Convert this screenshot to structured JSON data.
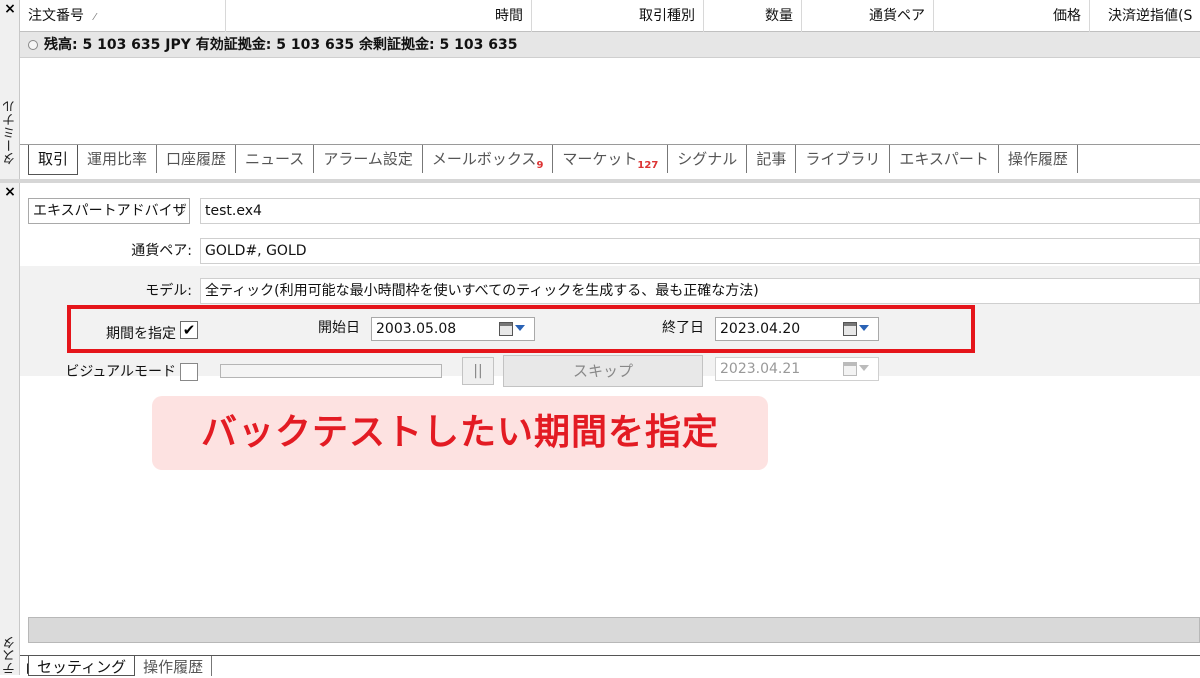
{
  "terminal": {
    "side_label": "ターミナル",
    "columns": [
      "注文番号",
      "時間",
      "取引種別",
      "数量",
      "通貨ペア",
      "価格",
      "決済逆指値(S"
    ],
    "balance_text": "残高: 5 103 635 JPY  有効証拠金: 5 103 635  余剰証拠金: 5 103 635",
    "tabs": [
      {
        "label": "取引",
        "badge": ""
      },
      {
        "label": "運用比率",
        "badge": ""
      },
      {
        "label": "口座履歴",
        "badge": ""
      },
      {
        "label": "ニュース",
        "badge": ""
      },
      {
        "label": "アラーム設定",
        "badge": ""
      },
      {
        "label": "メールボックス",
        "badge": "9"
      },
      {
        "label": "マーケット",
        "badge": "127"
      },
      {
        "label": "シグナル",
        "badge": ""
      },
      {
        "label": "記事",
        "badge": ""
      },
      {
        "label": "ライブラリ",
        "badge": ""
      },
      {
        "label": "エキスパート",
        "badge": ""
      },
      {
        "label": "操作履歴",
        "badge": ""
      }
    ]
  },
  "tester": {
    "side_label": "テスター",
    "mode_select": "エキスパートアドバイザ",
    "expert_file": "test.ex4",
    "symbol_label": "通貨ペア:",
    "symbol_value": "GOLD#, GOLD",
    "model_label": "モデル:",
    "model_value": "全ティック(利用可能な最小時間枠を使いすべてのティックを生成する、最も正確な方法)",
    "use_date_label": "期間を指定",
    "use_date_checked": true,
    "start_label": "開始日",
    "start_date": "2003.05.08",
    "end_label": "終了日",
    "end_date": "2023.04.20",
    "visual_label": "ビジュアルモード",
    "visual_checked": false,
    "pause_label": "||",
    "skip_label": "スキップ",
    "skip_date": "2023.04.21",
    "bottom_tabs": [
      "セッティング",
      "操作履歴"
    ]
  },
  "annotation": {
    "callout_text": "バックテストしたい期間を指定",
    "accent_color": "#e5151b",
    "callout_bg": "#fde2e1"
  }
}
